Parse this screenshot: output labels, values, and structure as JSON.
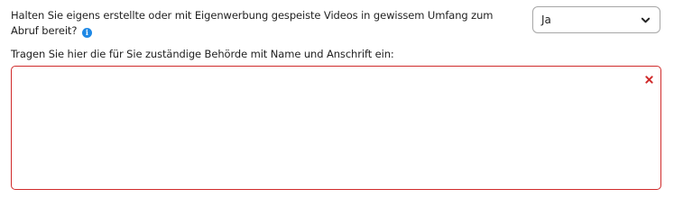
{
  "form": {
    "question_text": "Halten Sie eigens erstellte oder mit Eigenwerbung gespeiste Videos in gewissem Umfang zum Abruf bereit?",
    "info_icon_glyph": "i",
    "select": {
      "value": "Ja"
    },
    "authority_label": "Tragen Sie hier die für Sie zuständige Behörde mit Name und Anschrift ein:",
    "authority_value": "",
    "error_icon": "close-x-icon",
    "colors": {
      "info": "#1e88e5",
      "error": "#d02b2b",
      "border": "#a7a7a7"
    }
  }
}
